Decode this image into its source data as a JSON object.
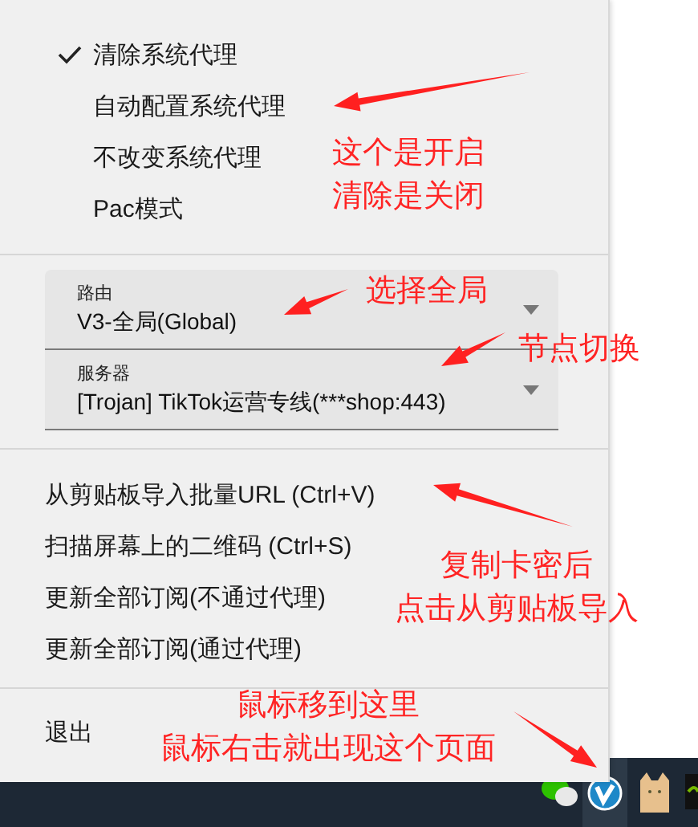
{
  "proxy_modes": [
    {
      "label": "清除系统代理",
      "checked": true
    },
    {
      "label": "自动配置系统代理",
      "checked": false
    },
    {
      "label": "不改变系统代理",
      "checked": false
    },
    {
      "label": "Pac模式",
      "checked": false
    }
  ],
  "selectors": [
    {
      "label": "路由",
      "value": "V3-全局(Global)"
    },
    {
      "label": "服务器",
      "value": "[Trojan] TikTok运营专线(***shop:443)"
    }
  ],
  "actions": [
    {
      "label": "从剪贴板导入批量URL (Ctrl+V)"
    },
    {
      "label": "扫描屏幕上的二维码 (Ctrl+S)"
    },
    {
      "label": "更新全部订阅(不通过代理)"
    },
    {
      "label": "更新全部订阅(通过代理)"
    }
  ],
  "exit": {
    "label": "退出"
  },
  "annotations": [
    {
      "lines": [
        "这个是开启",
        "清除是关闭"
      ]
    },
    {
      "lines": [
        "选择全局"
      ]
    },
    {
      "lines": [
        "节点切换"
      ]
    },
    {
      "lines": [
        "复制卡密后",
        "点击从剪贴板导入"
      ]
    },
    {
      "lines": [
        "鼠标移到这里",
        "鼠标右击就出现这个页面"
      ]
    }
  ]
}
